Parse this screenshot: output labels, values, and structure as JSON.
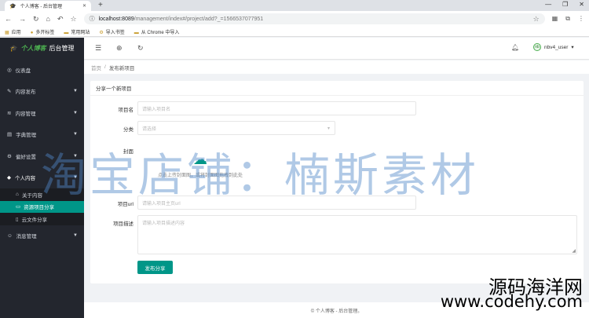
{
  "browser": {
    "tab_title": "个人博客 - 后台管理",
    "tab_icon": "graduation-cap-icon",
    "url_host": "localhost:8089",
    "url_path": "/management/index#/project/add?_=1566537077951",
    "bookmarks": [
      "应用",
      "多开标签",
      "常用网站",
      "导入书签",
      "从 Chrome 中导入"
    ]
  },
  "sidebar": {
    "brand_em": "个人博客",
    "brand_rest": "后台管理",
    "items": [
      {
        "label": "仪表盘",
        "icon": "dashboard-icon",
        "caret": false
      },
      {
        "label": "内容发布",
        "icon": "edit-icon",
        "caret": true
      },
      {
        "label": "内容管理",
        "icon": "layers-icon",
        "caret": true
      },
      {
        "label": "字典管理",
        "icon": "dictionary-icon",
        "caret": true
      },
      {
        "label": "偏好设置",
        "icon": "gear-icon",
        "caret": true
      },
      {
        "label": "个人内容",
        "icon": "diamond-icon",
        "caret": true,
        "open": true
      },
      {
        "label": "消息管理",
        "icon": "user-icon",
        "caret": true
      }
    ],
    "sub_items": [
      {
        "label": "关于内容",
        "icon": "home-icon",
        "active": false
      },
      {
        "label": "资源项目分享",
        "icon": "laptop-icon",
        "active": true
      },
      {
        "label": "云文件分享",
        "icon": "file-icon",
        "active": false
      }
    ]
  },
  "topbar": {
    "username": "nbv4_user",
    "avatar_text": "nb"
  },
  "breadcrumb": {
    "home": "首页",
    "sep": "/",
    "current": "发布新项目"
  },
  "form": {
    "title": "分享一个新项目",
    "name_label": "项目名",
    "name_placeholder": "请输入项目名",
    "category_label": "分类",
    "category_placeholder": "请选择",
    "cover_label": "封面",
    "upload_text": "点击上传封面图，或将封面图拖拽到此处",
    "url_label": "项目url",
    "url_placeholder": "请输入项目主页url",
    "desc_label": "项目描述",
    "desc_placeholder": "请输入项目描述内容",
    "submit_label": "发布分享"
  },
  "footer": {
    "text": "© 个人博客 - 后台管理。"
  },
  "watermarks": {
    "main": "淘宝店铺：楠斯素材",
    "line1": "源码海洋网",
    "line2": "www.codehy.com"
  }
}
